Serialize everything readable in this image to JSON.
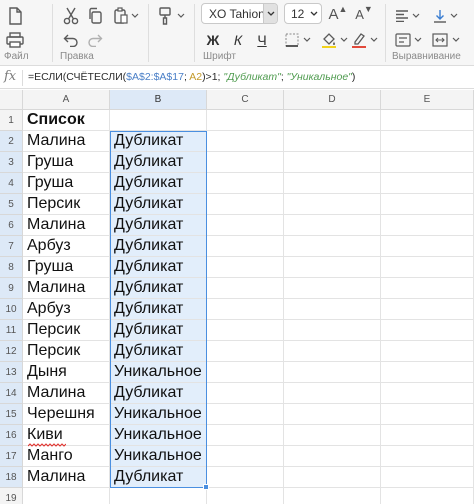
{
  "toolbar": {
    "font_name": "XO Tahion",
    "font_size": "12",
    "groups": {
      "file": "Файл",
      "edit": "Правка",
      "font": "Шрифт",
      "align": "Выравнивание"
    },
    "bold_glyph": "Ж",
    "italic_glyph": "К",
    "underline_glyph": "Ч",
    "grow_glyph": "A",
    "shrink_glyph": "A",
    "accent_color": "#4a8fe0"
  },
  "formula_bar": {
    "fx": "fx",
    "parts": {
      "p1": "=ЕСЛИ(СЧЁТЕСЛИ(",
      "p2": "$A$2:$A$17",
      "p3": "; ",
      "p4": "A2",
      "p5": ")>1; ",
      "p6": "\"Дубликат\"",
      "p7": "; ",
      "p8": "\"Уникальное\"",
      "p9": ")"
    }
  },
  "sheet": {
    "columns": [
      "A",
      "B",
      "C",
      "D",
      "E"
    ],
    "selected_column": "B",
    "row_numbers": [
      "1",
      "2",
      "3",
      "4",
      "5",
      "6",
      "7",
      "8",
      "9",
      "10",
      "11",
      "12",
      "13",
      "14",
      "15",
      "16",
      "17",
      "18",
      "19"
    ],
    "header_a": "Список",
    "col_a": [
      "Малина",
      "Груша",
      "Груша",
      "Персик",
      "Малина",
      "Арбуз",
      "Груша",
      "Малина",
      "Арбуз",
      "Персик",
      "Персик",
      "Дыня",
      "Малина",
      "Черешня",
      "Киви",
      "Манго",
      "Малина"
    ],
    "col_b": [
      "Дубликат",
      "Дубликат",
      "Дубликат",
      "Дубликат",
      "Дубликат",
      "Дубликат",
      "Дубликат",
      "Дубликат",
      "Дубликат",
      "Дубликат",
      "Дубликат",
      "Уникальное",
      "Дубликат",
      "Уникальное",
      "Уникальное",
      "Уникальное",
      "Дубликат"
    ]
  }
}
